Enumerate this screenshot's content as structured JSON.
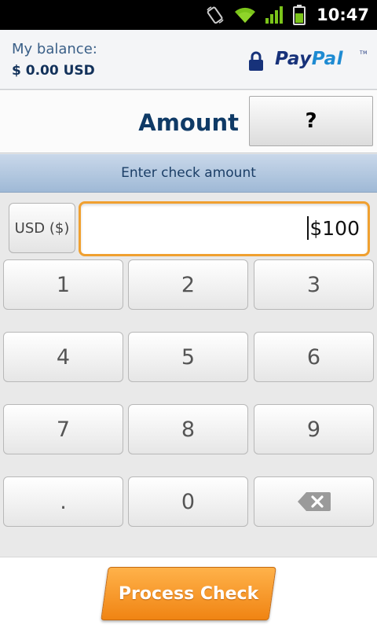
{
  "status_bar": {
    "time": "10:47",
    "icons": [
      "rotate-icon",
      "wifi-icon",
      "signal-icon",
      "battery-icon"
    ]
  },
  "header": {
    "balance_label": "My balance:",
    "balance_value": "$ 0.00 USD",
    "logo_pay": "Pay",
    "logo_pal": "Pal",
    "logo_tm": "TM"
  },
  "amount_row": {
    "title": "Amount",
    "help_label": "?"
  },
  "banner": {
    "text": "Enter check amount"
  },
  "currency": {
    "label": "USD ($)"
  },
  "amount_input": {
    "value": "$100"
  },
  "keypad": {
    "keys": [
      "1",
      "2",
      "3",
      "4",
      "5",
      "6",
      "7",
      "8",
      "9",
      ".",
      "0",
      "backspace"
    ]
  },
  "footer": {
    "process_label": "Process Check"
  },
  "colors": {
    "accent_orange": "#f08413",
    "input_focus": "#f0a030",
    "title_blue": "#0f3a66",
    "paypal_dark": "#17327a",
    "paypal_light": "#1e8bd2"
  }
}
